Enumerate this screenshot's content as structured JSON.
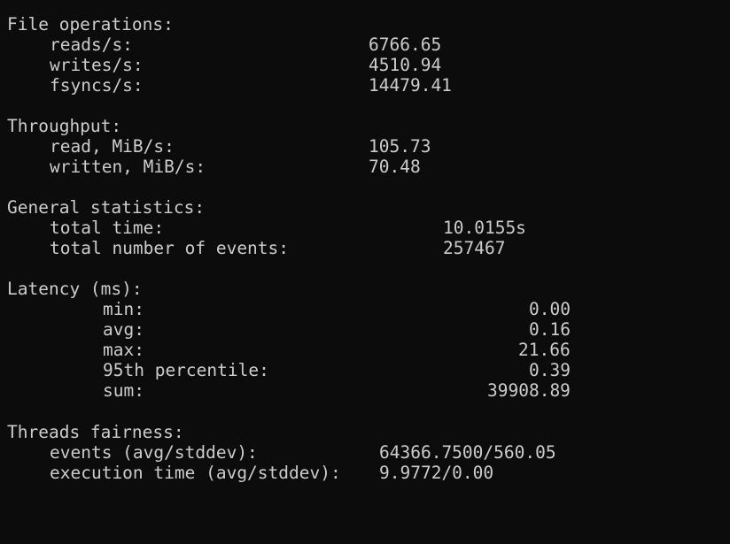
{
  "file_operations": {
    "heading": "File operations:",
    "rows": [
      {
        "label": "reads/s:",
        "value": "6766.65"
      },
      {
        "label": "writes/s:",
        "value": "4510.94"
      },
      {
        "label": "fsyncs/s:",
        "value": "14479.41"
      }
    ]
  },
  "throughput": {
    "heading": "Throughput:",
    "rows": [
      {
        "label": "read, MiB/s:",
        "value": "105.73"
      },
      {
        "label": "written, MiB/s:",
        "value": "70.48"
      }
    ]
  },
  "general_statistics": {
    "heading": "General statistics:",
    "rows": [
      {
        "label": "total time:",
        "value": "10.0155s"
      },
      {
        "label": "total number of events:",
        "value": "257467"
      }
    ]
  },
  "latency": {
    "heading": "Latency (ms):",
    "rows": [
      {
        "label": "min:",
        "value": "0.00"
      },
      {
        "label": "avg:",
        "value": "0.16"
      },
      {
        "label": "max:",
        "value": "21.66"
      },
      {
        "label": "95th percentile:",
        "value": "0.39"
      },
      {
        "label": "sum:",
        "value": "39908.89"
      }
    ]
  },
  "threads_fairness": {
    "heading": "Threads fairness:",
    "rows": [
      {
        "label": "events (avg/stddev):",
        "value": "64366.7500/560.05"
      },
      {
        "label": "execution time (avg/stddev):",
        "value": "9.9772/0.00"
      }
    ]
  }
}
